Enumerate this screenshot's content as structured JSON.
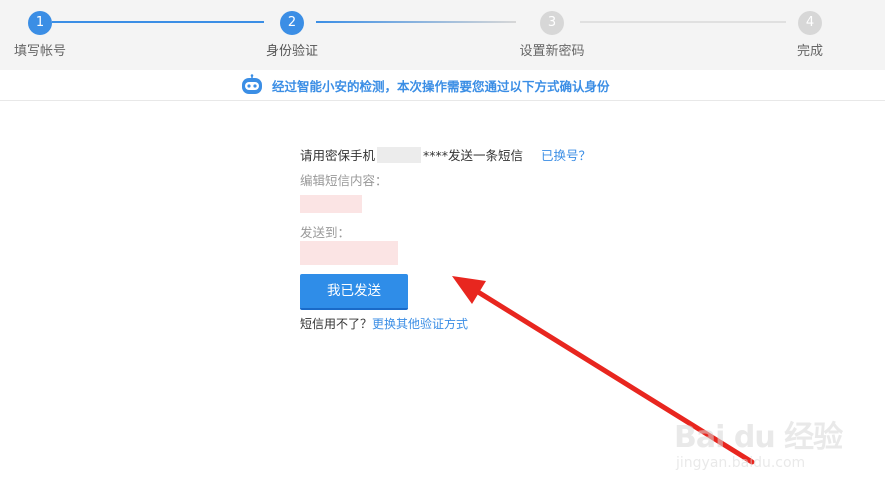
{
  "steps": [
    {
      "number": "1",
      "label": "填写帐号",
      "state": "done"
    },
    {
      "number": "2",
      "label": "身份验证",
      "state": "active"
    },
    {
      "number": "3",
      "label": "设置新密码",
      "state": "pending"
    },
    {
      "number": "4",
      "label": "完成",
      "state": "pending"
    }
  ],
  "notice": {
    "text": "经过智能小安的检测，本次操作需要您通过以下方式确认身份"
  },
  "sms": {
    "prefix": "请用密保手机",
    "masked_suffix": "****发送一条短信",
    "change_number_link": "已换号？",
    "content_label": "编辑短信内容：",
    "send_to_label": "发送到："
  },
  "send_button": {
    "label": "我已发送"
  },
  "fallback": {
    "question": "短信用不了？",
    "link": "更换其他验证方式"
  },
  "watermark": {
    "main": "Bai du 经验",
    "sub": "jingyan.baidu.com"
  },
  "colors": {
    "accent": "#3b8ee5",
    "button": "#2f8de8",
    "arrow": "#e8261f",
    "inactive": "#d7d7d7"
  }
}
